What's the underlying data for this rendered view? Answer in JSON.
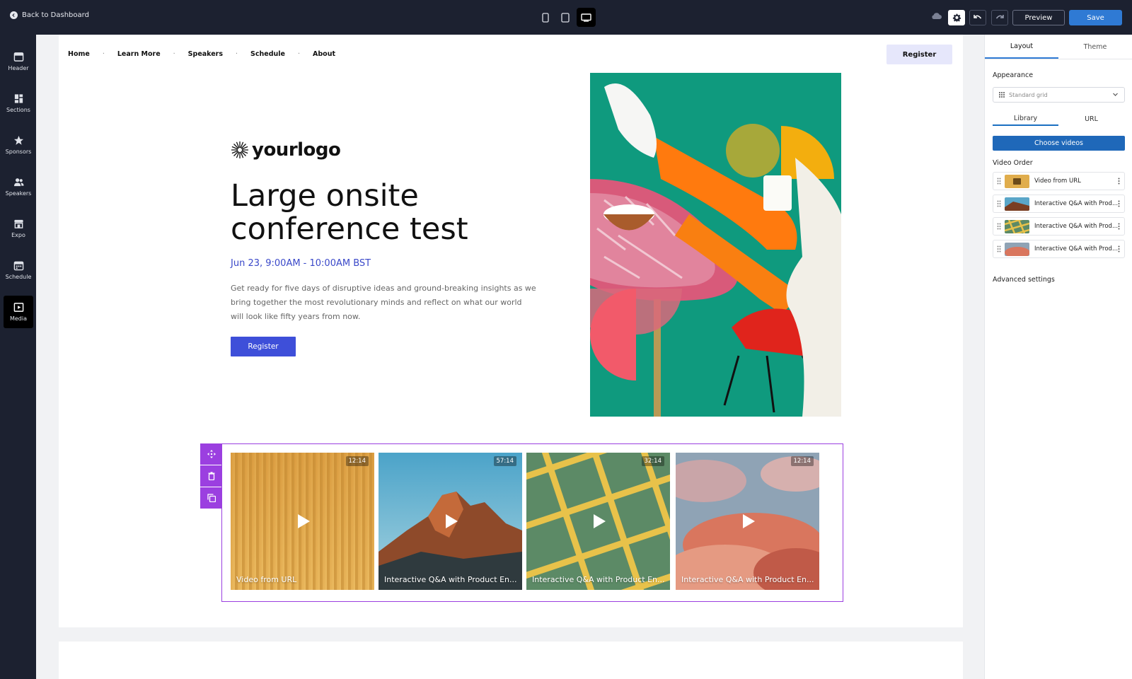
{
  "topbar": {
    "back_label": "Back to Dashboard",
    "preview_label": "Preview",
    "save_label": "Save",
    "devices": [
      "mobile-icon",
      "tablet-icon",
      "desktop-icon"
    ],
    "active_device": "desktop"
  },
  "leftrail": {
    "items": [
      {
        "label": "Header",
        "icon": "header-icon"
      },
      {
        "label": "Sections",
        "icon": "sections-icon"
      },
      {
        "label": "Sponsors",
        "icon": "star-icon"
      },
      {
        "label": "Speakers",
        "icon": "people-icon"
      },
      {
        "label": "Expo",
        "icon": "booth-icon"
      },
      {
        "label": "Schedule",
        "icon": "calendar-icon"
      },
      {
        "label": "Media",
        "icon": "media-icon"
      }
    ],
    "active": "Media"
  },
  "site": {
    "nav": [
      "Home",
      "Learn More",
      "Speakers",
      "Schedule",
      "About"
    ],
    "nav_register": "Register",
    "logo_text": "yourlogo",
    "title": "Large onsite conference test",
    "date": "Jun 23, 9:00AM - 10:00AM BST",
    "description": "Get ready for five days of disruptive ideas and ground-breaking insights as we bring together the most revolutionary minds and reflect on what our world will look like fifty years from now.",
    "register": "Register"
  },
  "videos": [
    {
      "title": "Video from URL",
      "duration": "12:14"
    },
    {
      "title": "Interactive Q&A with Product En...",
      "duration": "57:14"
    },
    {
      "title": "Interactive Q&A with Product En...",
      "duration": "32:14"
    },
    {
      "title": "Interactive Q&A with Product En...",
      "duration": "12:14"
    }
  ],
  "panel": {
    "tabs": [
      "Layout",
      "Theme"
    ],
    "active_tab": "Layout",
    "appearance_label": "Appearance",
    "appearance_value": "Standard grid",
    "subtabs": [
      "Library",
      "URL"
    ],
    "active_subtab": "Library",
    "choose_videos": "Choose videos",
    "video_order_label": "Video Order",
    "video_order": [
      "Video from URL",
      "Interactive Q&A with Prod...",
      "Interactive Q&A with Prod...",
      "Interactive Q&A with Prod..."
    ],
    "advanced_label": "Advanced settings"
  },
  "colors": {
    "topbar": "#1c2130",
    "accent_purple": "#9b3fe0",
    "brand_blue": "#3e4fd9",
    "save_blue": "#2f7ad4"
  }
}
